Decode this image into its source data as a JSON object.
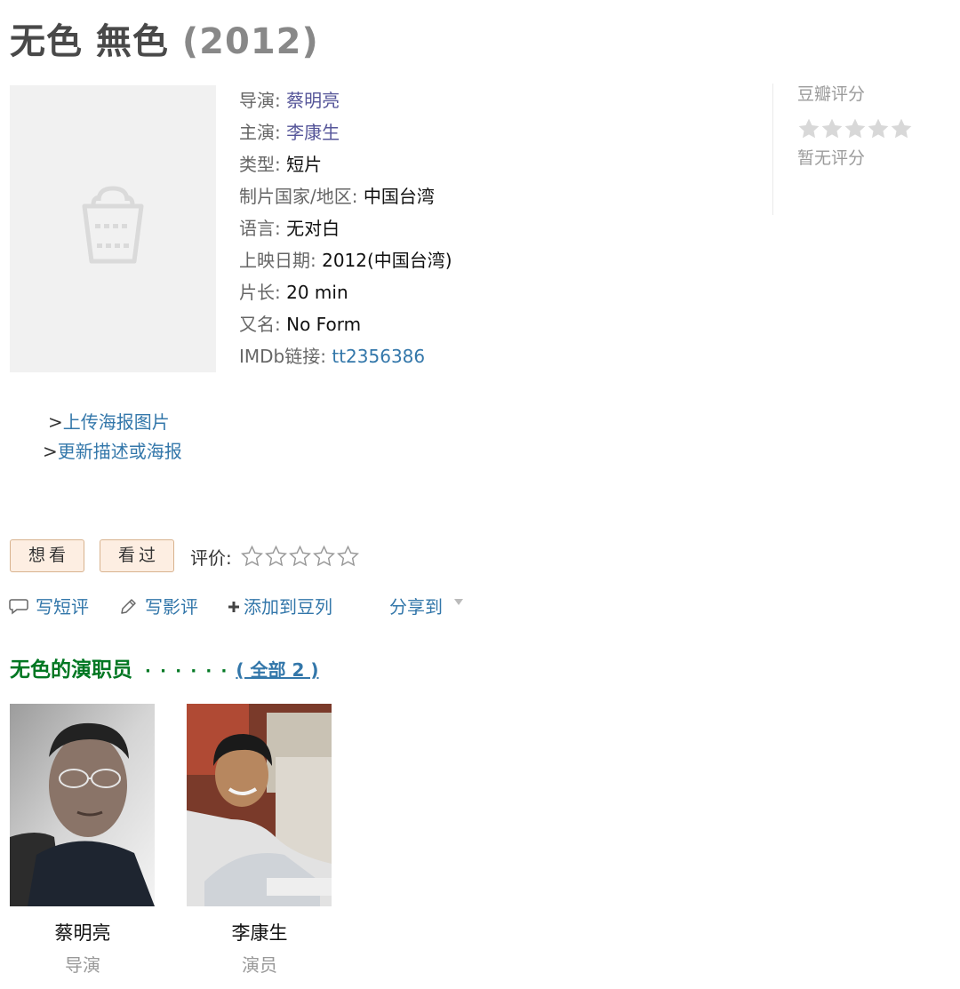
{
  "header": {
    "title": "无色 無色",
    "year": "(2012)"
  },
  "info": {
    "director_label": "导演: ",
    "director": "蔡明亮",
    "starring_label": "主演: ",
    "starring": "李康生",
    "genre_label": "类型: ",
    "genre": "短片",
    "country_label": "制片国家/地区: ",
    "country": "中国台湾",
    "language_label": "语言: ",
    "language": "无对白",
    "release_label": "上映日期: ",
    "release": "2012(中国台湾)",
    "runtime_label": "片长: ",
    "runtime": "20 min",
    "aka_label": "又名: ",
    "aka": "No Form",
    "imdb_label": "IMDb链接: ",
    "imdb": "tt2356386"
  },
  "rating_panel": {
    "title": "豆瓣评分",
    "no_rating": "暂无评分",
    "stars": 5
  },
  "poster_links": [
    {
      "prefix": ">",
      "label": "上传海报图片"
    },
    {
      "prefix": ">",
      "label": "更新描述或海报"
    }
  ],
  "interest": {
    "want_label": "想看",
    "seen_label": "看过",
    "rate_label": "评价:",
    "rate_stars": 5
  },
  "actions": {
    "short_review": "写短评",
    "review": "写影评",
    "add_to_list": "添加到豆列",
    "share": "分享到"
  },
  "cast_section": {
    "title": "无色的演职员",
    "dots": "· · · · · ·",
    "all": "( 全部 2 )"
  },
  "cast": [
    {
      "name": "蔡明亮",
      "role": "导演"
    },
    {
      "name": "李康生",
      "role": "演员"
    }
  ],
  "colors": {
    "link": "#3377aa",
    "green": "#007722",
    "button_bg": "#fdeee2"
  }
}
